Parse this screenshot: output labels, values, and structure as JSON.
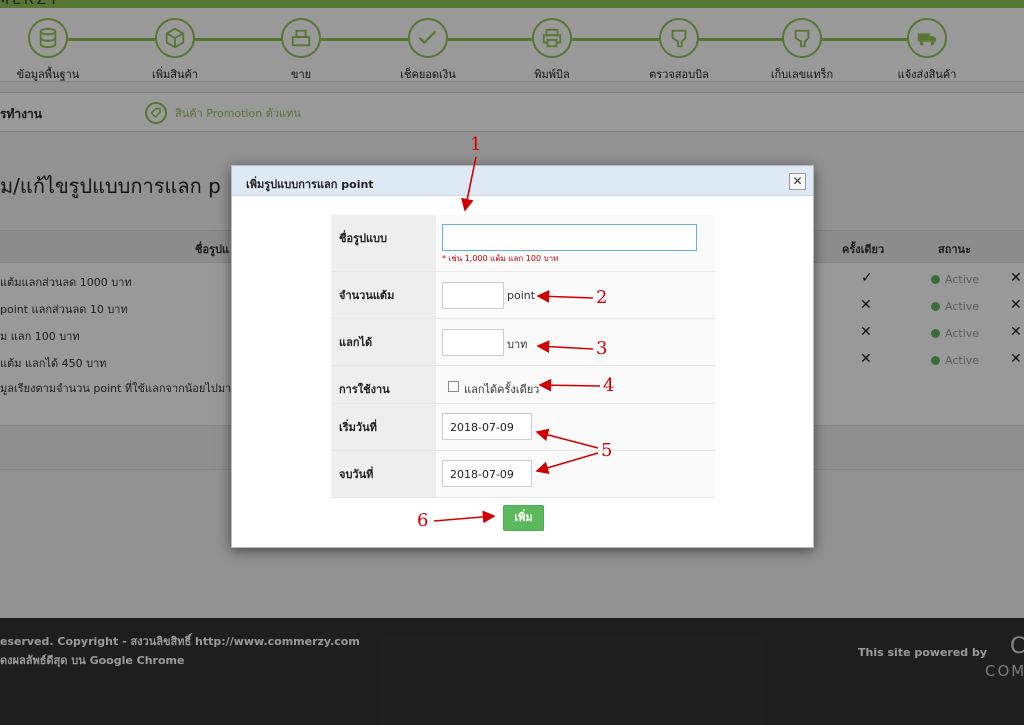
{
  "brand": {
    "partial_name": "MERZY"
  },
  "topnav": {
    "items": [
      {
        "label": "ข้อมูลพื้นฐาน",
        "icon": "database-icon"
      },
      {
        "label": "เพิ่มสินค้า",
        "icon": "box-icon"
      },
      {
        "label": "ขาย",
        "icon": "cash-register-icon"
      },
      {
        "label": "เช็คยอดเงิน",
        "icon": "check-money-icon"
      },
      {
        "label": "พิมพ์บิล",
        "icon": "printer-icon"
      },
      {
        "label": "ตรวจสอบบิล",
        "icon": "barcode-scanner-icon"
      },
      {
        "label": "เก็บเลขแทร็ก",
        "icon": "barcode-scanner-icon"
      },
      {
        "label": "แจ้งส่งสินค้า",
        "icon": "truck-icon"
      }
    ]
  },
  "subbar": {
    "title": "รทำงาน",
    "promo_link": "สินค้า Promotion ตัวแทน"
  },
  "page": {
    "heading": "ม/แก้ไขรูปแบบการแลก p"
  },
  "table": {
    "headers": {
      "name": "ชื่อรูปแ",
      "once": "ครั้งเดียว",
      "status": "สถานะ"
    },
    "rows": [
      {
        "name": "แต้มแลกส่วนลด 1000 บาท",
        "once": "✓",
        "status": "Active",
        "action": "✕"
      },
      {
        "name": "point แลกส่วนลด 10 บาท",
        "once": "✕",
        "status": "Active",
        "action": "✕"
      },
      {
        "name": "ม แลก 100 บาท",
        "once": "✕",
        "status": "Active",
        "action": "✕"
      },
      {
        "name": "แต้ม แลกได้ 450 บาท",
        "once": "✕",
        "status": "Active",
        "action": "✕"
      }
    ],
    "note": "มูลเรียงตามจำนวน point ที่ใช้แลกจากน้อยไปมาก"
  },
  "modal": {
    "title": "เพิ่มรูปแบบการแลก point",
    "close_label": "✕",
    "fields": {
      "name_label": "ชื่อรูปแบบ",
      "name_value": "",
      "name_hint": "* เช่น 1,000 แต้ม แลก 100 บาท",
      "points_label": "จำนวนแต้ม",
      "points_value": "",
      "points_unit": "point",
      "exchange_label": "แลกได้",
      "exchange_value": "",
      "exchange_unit": "บาท",
      "usage_label": "การใช้งาน",
      "usage_checkbox_label": "แลกได้ครั้งเดียว",
      "start_label": "เริ่มวันที่",
      "start_value": "2018-07-09",
      "end_label": "จบวันที่",
      "end_value": "2018-07-09"
    },
    "add_button": "เพิ่ม"
  },
  "annotations": {
    "n1": "1",
    "n2": "2",
    "n3": "3",
    "n4": "4",
    "n5": "5",
    "n6": "6"
  },
  "footer": {
    "line1": "eserved. Copyright - สงวนลิขสิทธิ์ http://www.commerzy.com",
    "line2": "ดงผลลัพธ์ดีสุด บน Google Chrome",
    "powered": "This site powered by",
    "logo_letter": "C",
    "logo_text": "COM"
  },
  "colors": {
    "accent": "#8fc552",
    "active": "#5cb85c",
    "annotation": "#d00000",
    "footer": "#333333"
  }
}
